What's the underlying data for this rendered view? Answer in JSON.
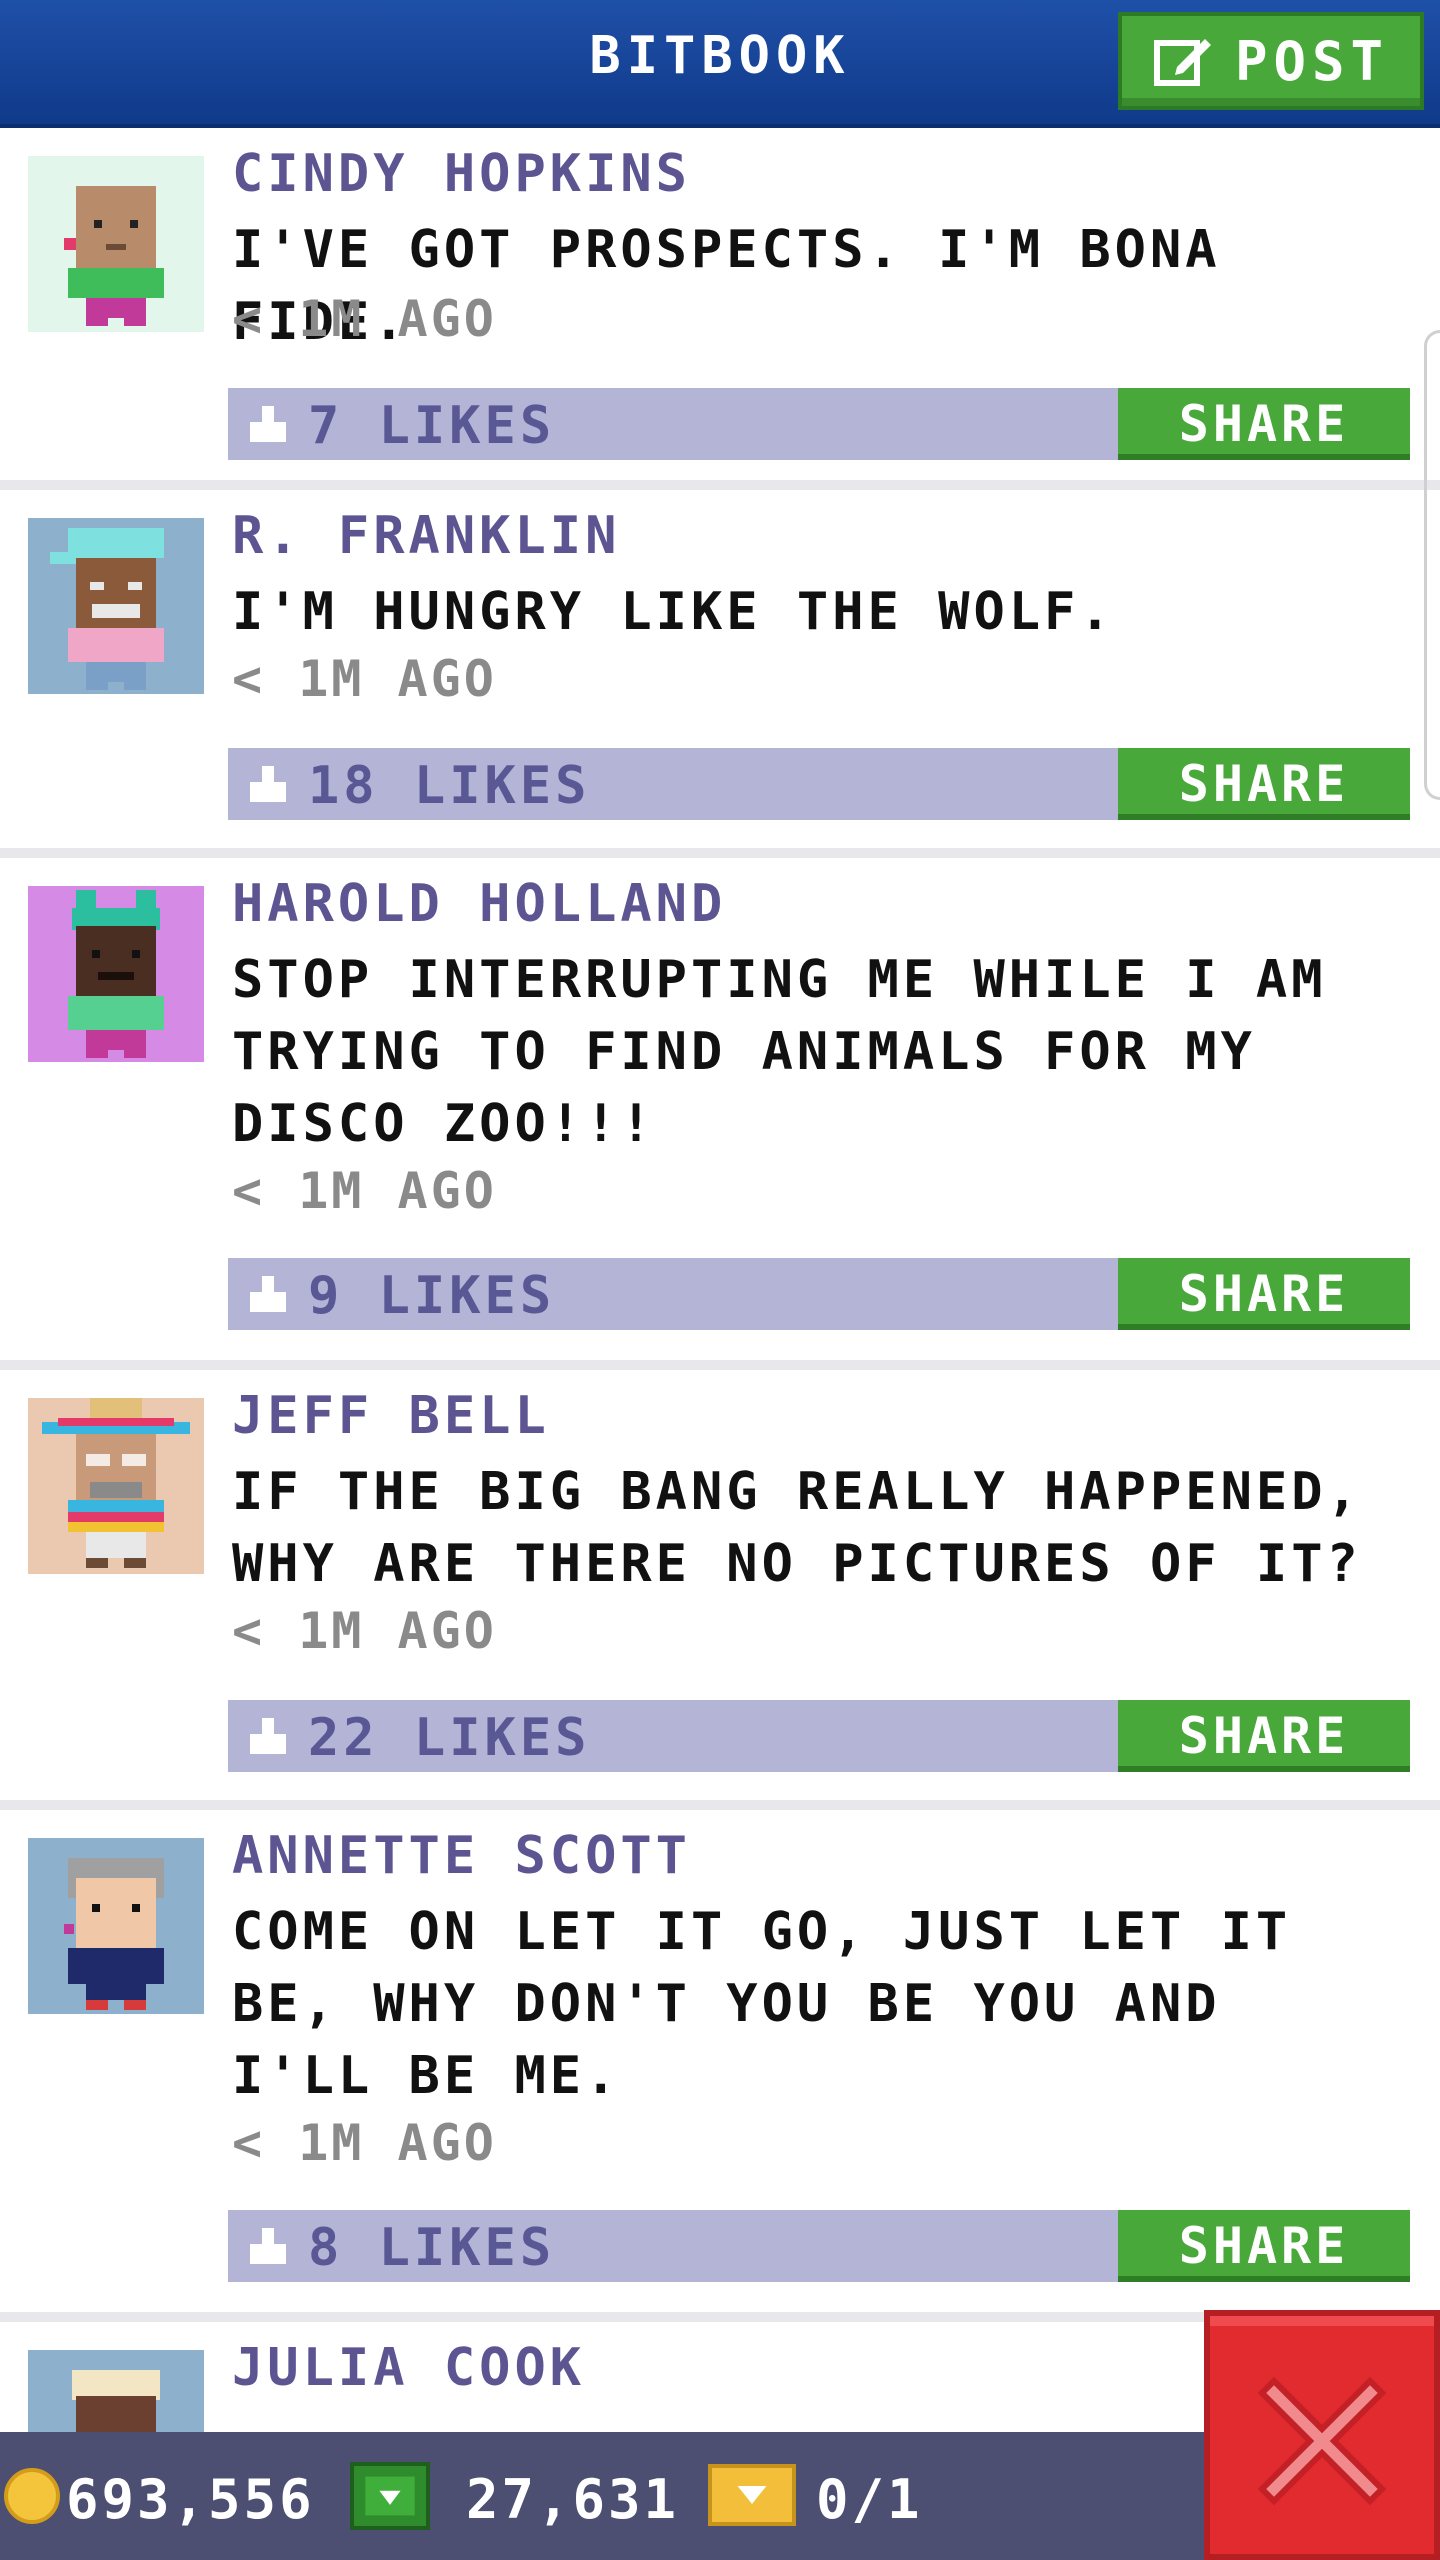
{
  "header": {
    "title": "BITBOOK",
    "post_label": "POST"
  },
  "posts": [
    {
      "name": "CINDY HOPKINS",
      "text": "I'VE GOT PROSPECTS. I'M BONA FIDE.",
      "time": "< 1M AGO",
      "likes": "7 LIKES",
      "share": "SHARE",
      "avatar_bg": "#e3f6ec"
    },
    {
      "name": "R. FRANKLIN",
      "text": "I'M HUNGRY LIKE THE WOLF.",
      "time": "< 1M AGO",
      "likes": "18 LIKES",
      "share": "SHARE",
      "avatar_bg": "#8db1cc"
    },
    {
      "name": "HAROLD HOLLAND",
      "text": "STOP INTERRUPTING ME WHILE I AM TRYING TO FIND ANIMALS FOR MY DISCO ZOO!!!",
      "time": "< 1M AGO",
      "likes": "9 LIKES",
      "share": "SHARE",
      "avatar_bg": "#d58be6"
    },
    {
      "name": "JEFF BELL",
      "text": "IF THE BIG BANG REALLY HAPPENED, WHY ARE THERE NO PICTURES OF IT?",
      "time": "< 1M AGO",
      "likes": "22 LIKES",
      "share": "SHARE",
      "avatar_bg": "#ebc8b0"
    },
    {
      "name": "ANNETTE SCOTT",
      "text": "COME ON LET IT GO, JUST LET IT BE, WHY DON'T YOU BE YOU AND I'LL BE ME.",
      "time": "< 1M AGO",
      "likes": "8 LIKES",
      "share": "SHARE",
      "avatar_bg": "#8db1cc"
    },
    {
      "name": "JULIA COOK",
      "avatar_bg": "#8db1cc"
    }
  ],
  "footer": {
    "coins": "693,556",
    "cash": "27,631",
    "tickets": "0/1"
  },
  "colors": {
    "header": "#1f50a8",
    "accent_green": "#49a83a",
    "likes_bar": "#b3b4d6",
    "name_color": "#5c5592",
    "close_red": "#e12b2f"
  }
}
